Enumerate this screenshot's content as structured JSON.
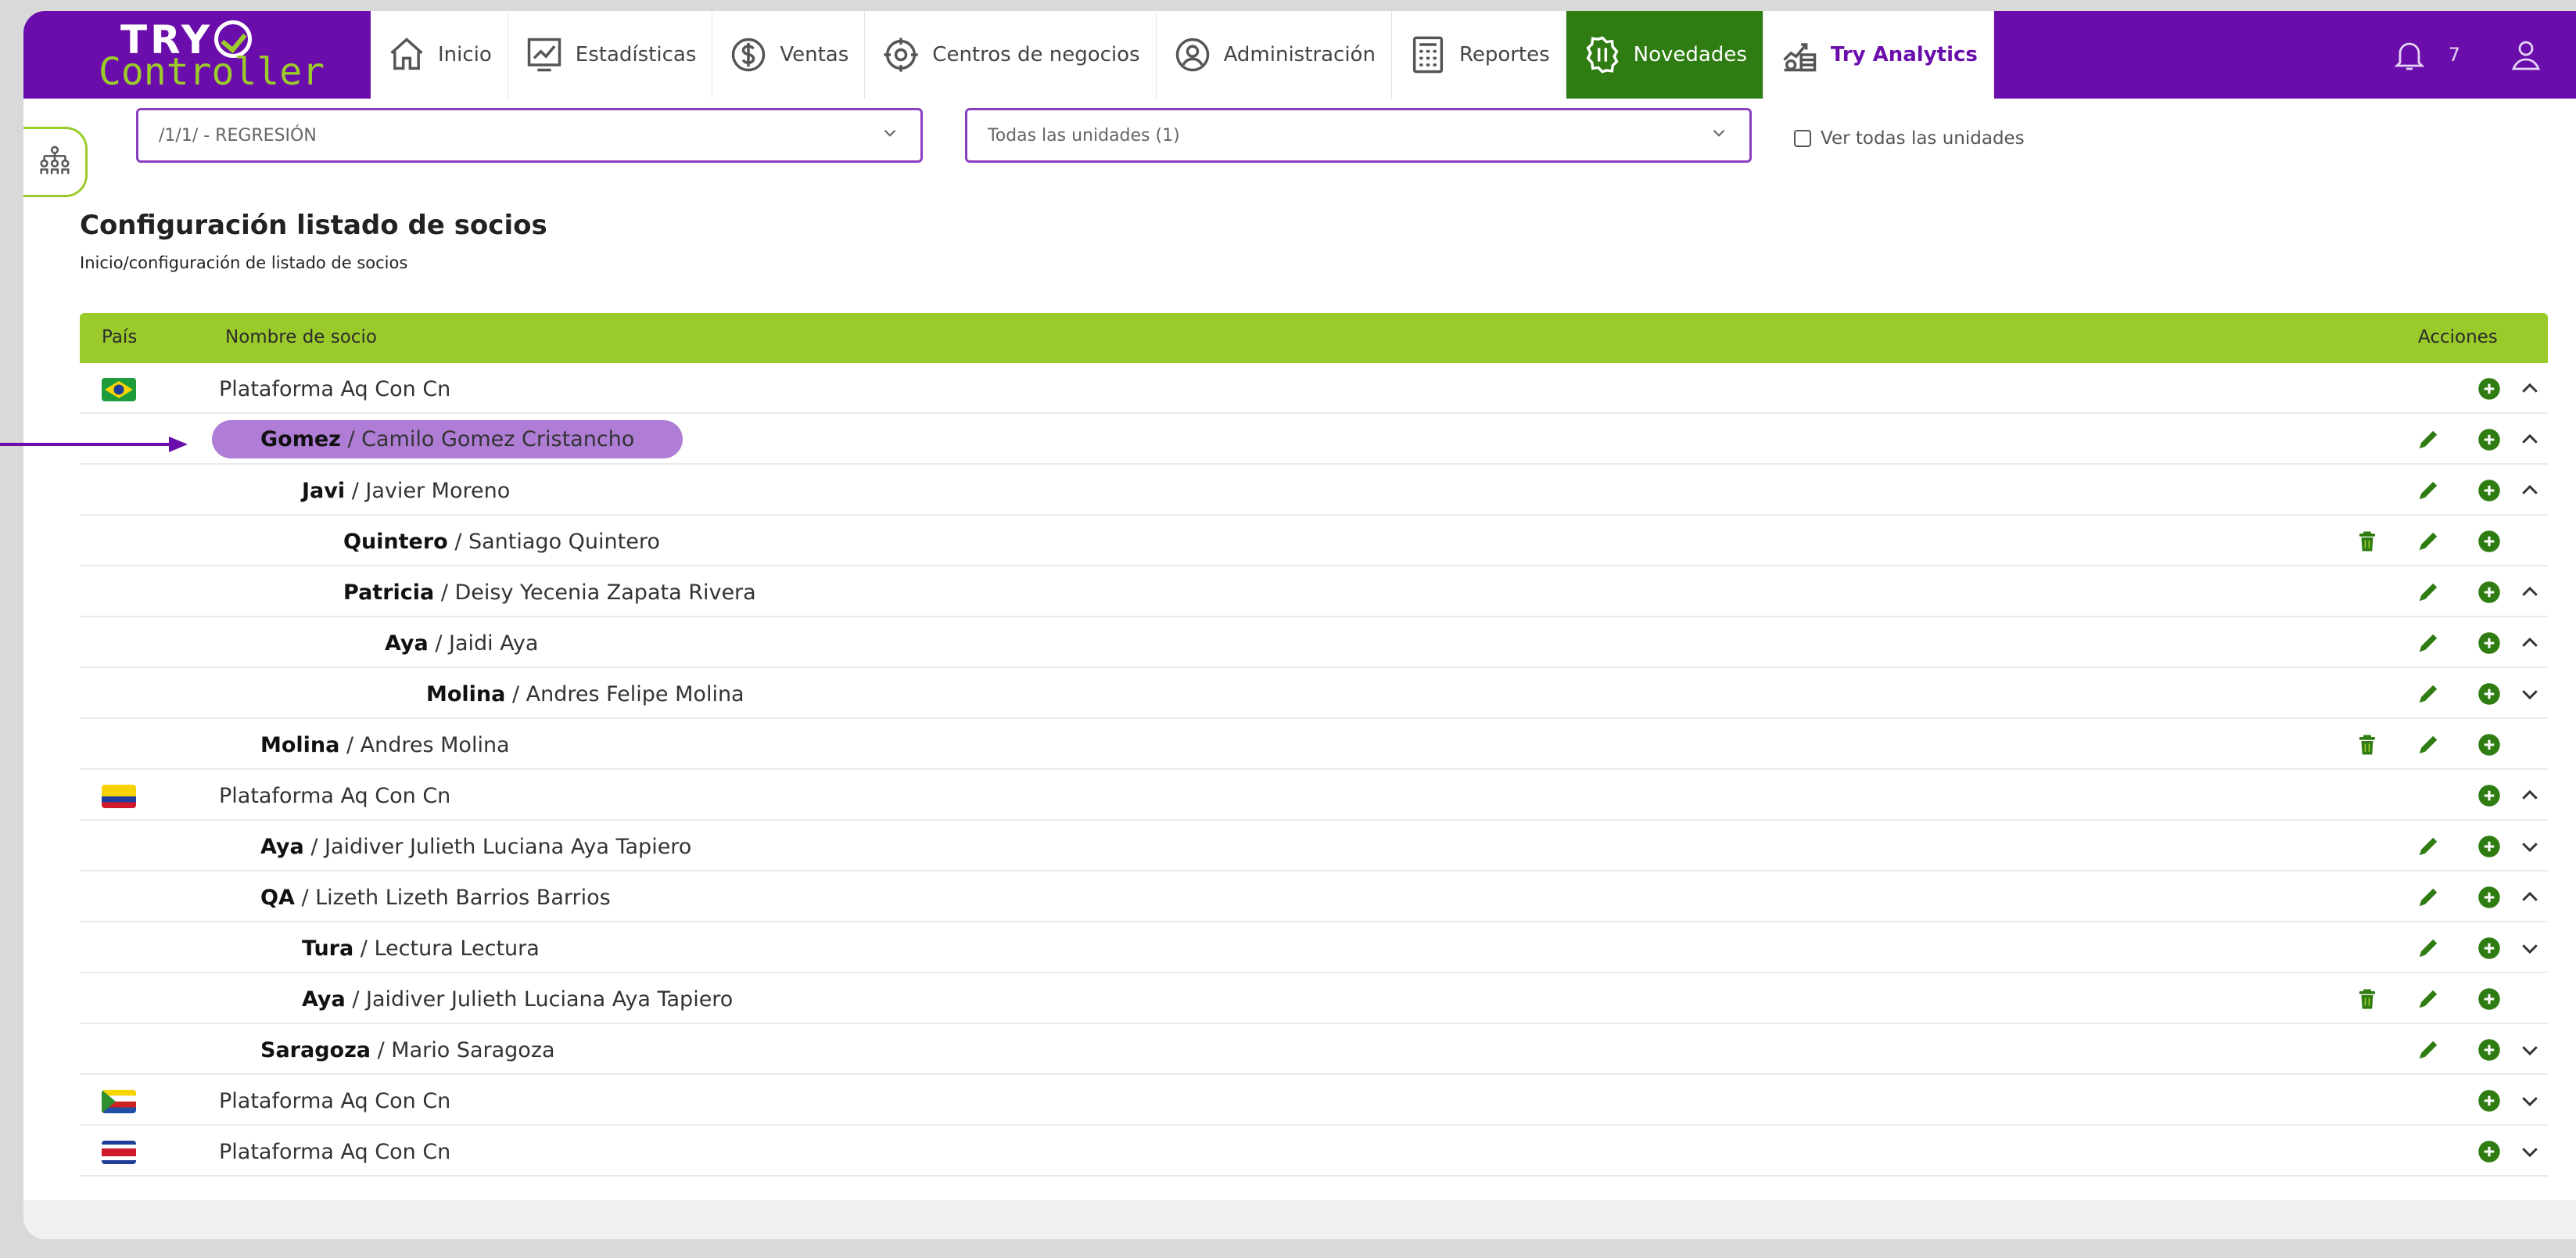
{
  "nav": {
    "logo_top": "TRY",
    "logo_bottom": "Controller",
    "menu": [
      {
        "label": "Inicio",
        "icon": "home-icon"
      },
      {
        "label": "Estadísticas",
        "icon": "chart-icon"
      },
      {
        "label": "Ventas",
        "icon": "dollar-icon"
      },
      {
        "label": "Centros de negocios",
        "icon": "business-center-icon"
      },
      {
        "label": "Administración",
        "icon": "admin-icon"
      },
      {
        "label": "Reportes",
        "icon": "report-icon"
      },
      {
        "label": "Novedades",
        "icon": "news-icon"
      },
      {
        "label": "Try Analytics",
        "icon": "analytics-icon"
      }
    ],
    "notification_count": "7"
  },
  "filters": {
    "period": "/1/1/ - REGRESIÓN",
    "units": "Todas las unidades (1)",
    "see_all_label": "Ver todas las unidades"
  },
  "page": {
    "title": "Configuración listado de socios",
    "breadcrumb": "Inicio/configuración de listado de socios"
  },
  "table": {
    "headers": {
      "country": "País",
      "name": "Nombre de socio",
      "actions": "Acciones"
    },
    "rows": [
      {
        "level": 0,
        "flag": "brazil",
        "code": "",
        "full": "Plataforma Aq Con Cn",
        "del": false,
        "edit": false,
        "chev": "up"
      },
      {
        "level": 1,
        "flag": "",
        "code": "Gomez",
        "full": "Camilo Gomez Cristancho",
        "del": false,
        "edit": true,
        "chev": "up",
        "highlight": true
      },
      {
        "level": 2,
        "flag": "",
        "code": "Javi",
        "full": "Javier Moreno",
        "del": false,
        "edit": true,
        "chev": "up"
      },
      {
        "level": 3,
        "flag": "",
        "code": "Quintero",
        "full": "Santiago Quintero",
        "del": true,
        "edit": true,
        "chev": ""
      },
      {
        "level": 3,
        "flag": "",
        "code": "Patricia",
        "full": "Deisy Yecenia Zapata Rivera",
        "del": false,
        "edit": true,
        "chev": "up"
      },
      {
        "level": 4,
        "flag": "",
        "code": "Aya",
        "full": "Jaidi Aya",
        "del": false,
        "edit": true,
        "chev": "up"
      },
      {
        "level": 5,
        "flag": "",
        "code": "Molina",
        "full": "Andres Felipe Molina",
        "del": false,
        "edit": true,
        "chev": "down"
      },
      {
        "level": 1,
        "flag": "",
        "code": "Molina",
        "full": "Andres Molina",
        "del": true,
        "edit": true,
        "chev": ""
      },
      {
        "level": 0,
        "flag": "colombia",
        "code": "",
        "full": "Plataforma Aq Con Cn",
        "del": false,
        "edit": false,
        "chev": "up"
      },
      {
        "level": 1,
        "flag": "",
        "code": "Aya",
        "full": "Jaidiver Julieth Luciana Aya Tapiero",
        "del": false,
        "edit": true,
        "chev": "down"
      },
      {
        "level": 1,
        "flag": "",
        "code": "QA",
        "full": "Lizeth Lizeth Barrios Barrios",
        "del": false,
        "edit": true,
        "chev": "up"
      },
      {
        "level": 2,
        "flag": "",
        "code": "Tura",
        "full": "Lectura Lectura",
        "del": false,
        "edit": true,
        "chev": "down"
      },
      {
        "level": 2,
        "flag": "",
        "code": "Aya",
        "full": "Jaidiver Julieth Luciana Aya Tapiero",
        "del": true,
        "edit": true,
        "chev": ""
      },
      {
        "level": 1,
        "flag": "",
        "code": "Saragoza",
        "full": "Mario Saragoza",
        "del": false,
        "edit": true,
        "chev": "down"
      },
      {
        "level": 0,
        "flag": "comoros",
        "code": "",
        "full": "Plataforma Aq Con Cn",
        "del": false,
        "edit": false,
        "chev": "down"
      },
      {
        "level": 0,
        "flag": "costa-rica",
        "code": "",
        "full": "Plataforma Aq Con Cn",
        "del": false,
        "edit": false,
        "chev": "down"
      }
    ]
  },
  "colors": {
    "brand_purple": "#6a0dab",
    "header_green": "#9bcb2a",
    "action_green": "#2f7d12",
    "highlight_purple": "#b07dd6"
  }
}
